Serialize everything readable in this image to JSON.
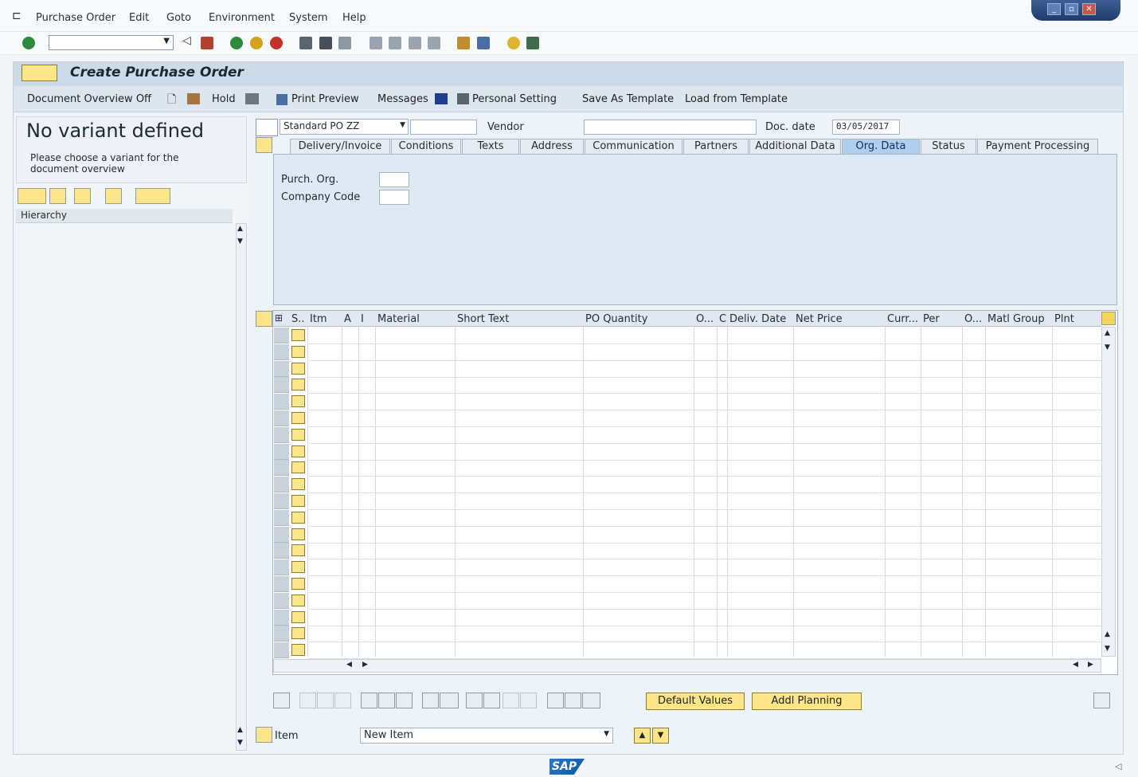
{
  "menu": {
    "items": [
      "Purchase Order",
      "Edit",
      "Goto",
      "Environment",
      "System",
      "Help"
    ]
  },
  "window_controls": {
    "minimize": "_",
    "restore": "▫",
    "close": "✕"
  },
  "header": {
    "title": "Create Purchase Order"
  },
  "app_toolbar": {
    "doc_overview": "Document Overview Off",
    "hold": "Hold",
    "print_preview": "Print Preview",
    "messages": "Messages",
    "personal_setting": "Personal Setting",
    "save_template": "Save As Template",
    "load_template": "Load from Template"
  },
  "variant": {
    "title": "No variant defined",
    "message": "Please choose a variant for the document overview"
  },
  "hierarchy": {
    "label": "Hierarchy"
  },
  "header_fields": {
    "po_type": "Standard PO ZZ",
    "vendor_label": "Vendor",
    "doc_date_label": "Doc. date",
    "doc_date": "03/05/2017"
  },
  "tabs": [
    {
      "label": "Delivery/Invoice",
      "active": false
    },
    {
      "label": "Conditions",
      "active": false
    },
    {
      "label": "Texts",
      "active": false
    },
    {
      "label": "Address",
      "active": false
    },
    {
      "label": "Communication",
      "active": false
    },
    {
      "label": "Partners",
      "active": false
    },
    {
      "label": "Additional Data",
      "active": false
    },
    {
      "label": "Org. Data",
      "active": true
    },
    {
      "label": "Status",
      "active": false
    },
    {
      "label": "Payment Processing",
      "active": false
    }
  ],
  "org_data": {
    "purch_org_label": "Purch. Org.",
    "company_code_label": "Company Code"
  },
  "items_table": {
    "columns": [
      "S..",
      "Itm",
      "A",
      "I",
      "Material",
      "Short Text",
      "PO Quantity",
      "O...",
      "C",
      "Deliv. Date",
      "Net Price",
      "Curr...",
      "Per",
      "O...",
      "Matl Group",
      "Plnt"
    ],
    "rows": 20
  },
  "item_buttons": {
    "default_values": "Default Values",
    "addl_planning": "Addl Planning"
  },
  "item_detail": {
    "label": "Item",
    "selected": "New Item"
  },
  "footer": {
    "logo": "SAP"
  },
  "colors": {
    "accent": "#b2ceef",
    "button": "#fde68a"
  }
}
